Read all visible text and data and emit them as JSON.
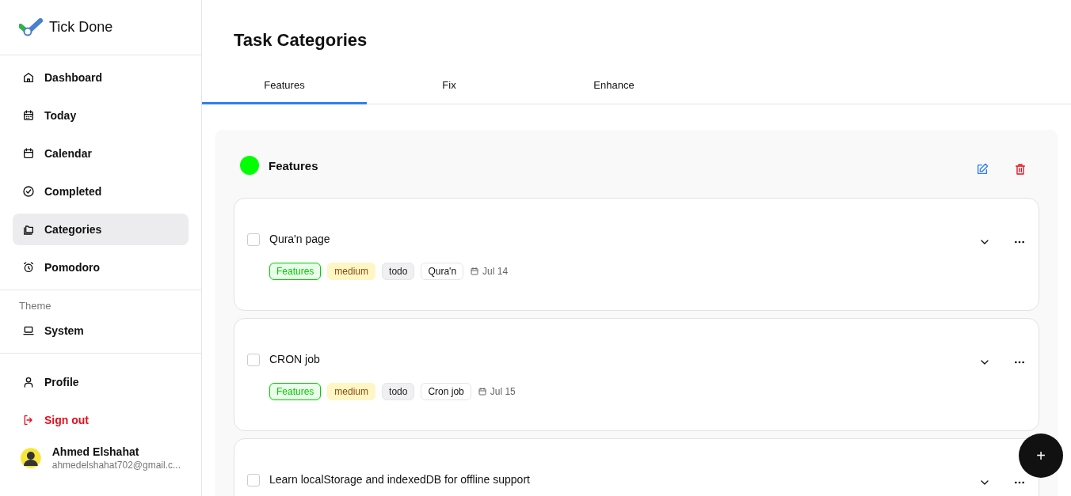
{
  "app": {
    "name": "Tick Done"
  },
  "sidebar": {
    "items": [
      {
        "label": "Dashboard",
        "selected": false
      },
      {
        "label": "Today",
        "selected": false
      },
      {
        "label": "Calendar",
        "selected": false
      },
      {
        "label": "Completed",
        "selected": false
      },
      {
        "label": "Categories",
        "selected": true
      },
      {
        "label": "Pomodoro",
        "selected": false
      }
    ],
    "theme": {
      "label": "Theme",
      "value": "System"
    },
    "profile": "Profile",
    "sign_out": "Sign out",
    "user": {
      "name": "Ahmed Elshahat",
      "email": "ahmedelshahat702@gmail.c..."
    }
  },
  "page": {
    "title": "Task Categories"
  },
  "tabs": [
    {
      "label": "Features",
      "selected": true
    },
    {
      "label": "Fix",
      "selected": false
    },
    {
      "label": "Enhance",
      "selected": false
    }
  ],
  "category": {
    "name": "Features",
    "color": "#00ff00"
  },
  "tasks": [
    {
      "title": "Qura'n page",
      "checked": false,
      "tags": [
        {
          "kind": "category",
          "text": "Features"
        },
        {
          "kind": "priority",
          "text": "medium"
        },
        {
          "kind": "status",
          "text": "todo"
        },
        {
          "kind": "label",
          "text": "Qura'n"
        }
      ],
      "date": "Jul 14"
    },
    {
      "title": "CRON job",
      "checked": false,
      "tags": [
        {
          "kind": "category",
          "text": "Features"
        },
        {
          "kind": "priority",
          "text": "medium"
        },
        {
          "kind": "status",
          "text": "todo"
        },
        {
          "kind": "label",
          "text": "Cron job"
        }
      ],
      "date": "Jul 15"
    },
    {
      "title": "Learn localStorage and indexedDB for offline support",
      "checked": false
    }
  ],
  "fab": "+"
}
